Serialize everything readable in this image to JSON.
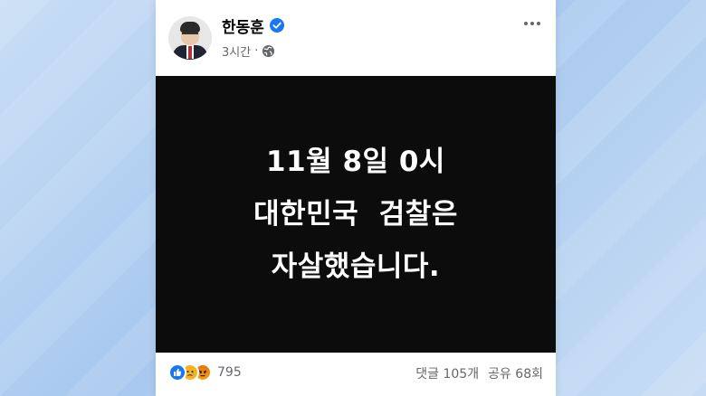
{
  "post": {
    "author_name": "한동훈",
    "time": "3시간",
    "dot": "·",
    "media_lines": [
      "11월 8일 0시",
      "대한민국  검찰은",
      "자살했습니다."
    ],
    "reaction_count": "795",
    "comments": "댓글 105개",
    "shares": "공유 68회"
  },
  "icons": {
    "verified": "verified-badge-icon",
    "privacy": "globe-icon",
    "more": "more-options-icon",
    "reactions": [
      "like-icon",
      "sad-icon",
      "angry-icon"
    ]
  },
  "colors": {
    "accent": "#1877f2",
    "text_secondary": "#65676b",
    "media_bg": "#0c0c0c"
  }
}
